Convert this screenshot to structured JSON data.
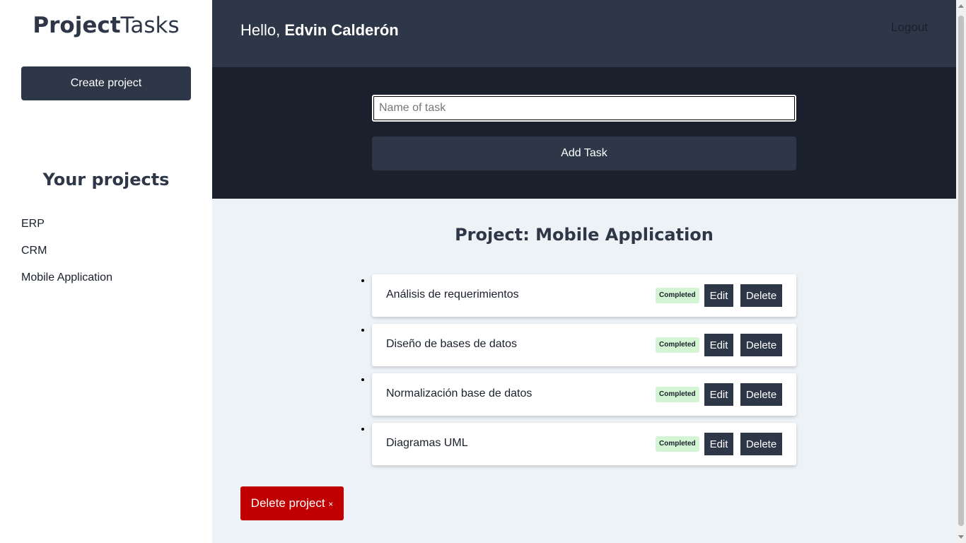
{
  "sidebar": {
    "logo_bold": "Project",
    "logo_light": "Tasks",
    "create_label": "Create project",
    "projects_heading": "Your projects",
    "projects": [
      "ERP",
      "CRM",
      "Mobile Application"
    ]
  },
  "header": {
    "greeting": "Hello,",
    "user_name": "Edvin Calderón",
    "logout_label": "Logout"
  },
  "task_form": {
    "placeholder": "Name of task",
    "value": "",
    "add_label": "Add Task"
  },
  "project": {
    "title": "Project: Mobile Application",
    "tasks": [
      {
        "name": "Análisis de requerimientos",
        "status": "Completed",
        "edit": "Edit",
        "delete": "Delete"
      },
      {
        "name": "Diseño de bases de datos",
        "status": "Completed",
        "edit": "Edit",
        "delete": "Delete"
      },
      {
        "name": "Normalización base de datos",
        "status": "Completed",
        "edit": "Edit",
        "delete": "Delete"
      },
      {
        "name": "Diagramas UML",
        "status": "Completed",
        "edit": "Edit",
        "delete": "Delete"
      }
    ],
    "delete_project_label": "Delete project",
    "delete_project_symbol": "×"
  },
  "colors": {
    "primary": "#2d3748",
    "dark": "#1a202c",
    "background": "#edf2f7",
    "danger": "#c00000",
    "completed_badge": "#d4f5d4"
  }
}
